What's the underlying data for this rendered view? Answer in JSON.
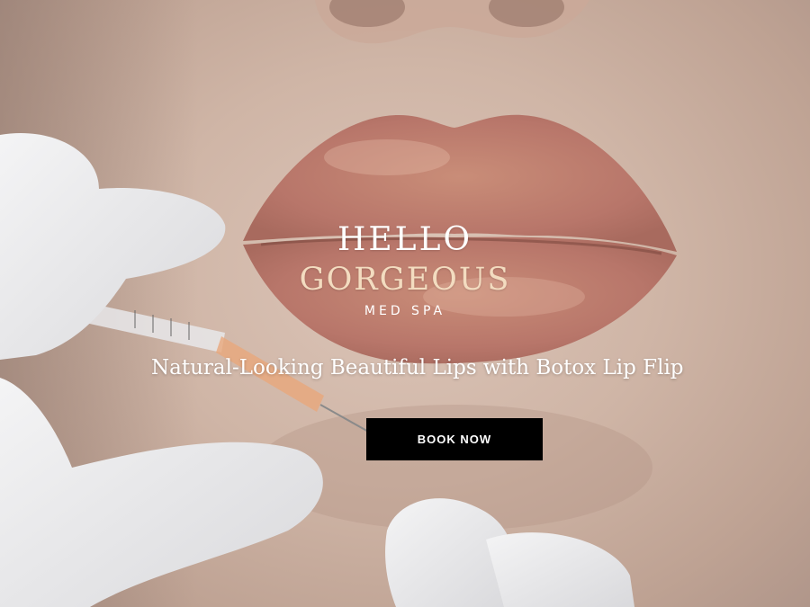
{
  "logo": {
    "line1": "HELLO",
    "line2": "GORGEOUS",
    "tagline": "MED SPA"
  },
  "hero": {
    "headline": "Natural-Looking Beautiful Lips with Botox Lip Flip",
    "cta_label": "BOOK NOW"
  },
  "colors": {
    "cta_background": "#000000",
    "logo_accent": "#f3dcc0",
    "text_primary": "#ffffff"
  }
}
